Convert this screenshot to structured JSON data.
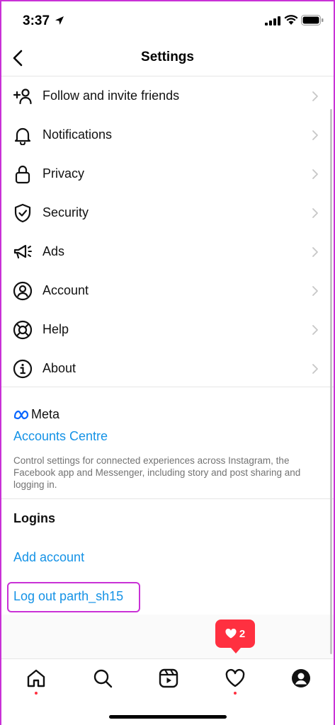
{
  "status_bar": {
    "time": "3:37"
  },
  "nav": {
    "title": "Settings"
  },
  "menu": {
    "items": [
      {
        "label": "Follow and invite friends",
        "icon": "add-person-icon"
      },
      {
        "label": "Notifications",
        "icon": "bell-icon"
      },
      {
        "label": "Privacy",
        "icon": "lock-icon"
      },
      {
        "label": "Security",
        "icon": "shield-icon"
      },
      {
        "label": "Ads",
        "icon": "megaphone-icon"
      },
      {
        "label": "Account",
        "icon": "person-circle-icon"
      },
      {
        "label": "Help",
        "icon": "lifebuoy-icon"
      },
      {
        "label": "About",
        "icon": "info-icon"
      }
    ]
  },
  "meta": {
    "brand": "Meta",
    "accounts_centre": "Accounts Centre",
    "description": "Control settings for connected experiences across Instagram, the Facebook app and Messenger, including story and post sharing and logging in."
  },
  "logins": {
    "heading": "Logins",
    "add_account": "Add account",
    "logout": "Log out parth_sh15"
  },
  "notification_bubble": {
    "count": "2"
  },
  "colors": {
    "link_blue": "#1492e6",
    "alert_red": "#ff3040",
    "highlight_magenta": "#c931d6"
  },
  "tabs": [
    "home-icon",
    "search-icon",
    "reels-icon",
    "heart-icon",
    "profile-icon"
  ]
}
